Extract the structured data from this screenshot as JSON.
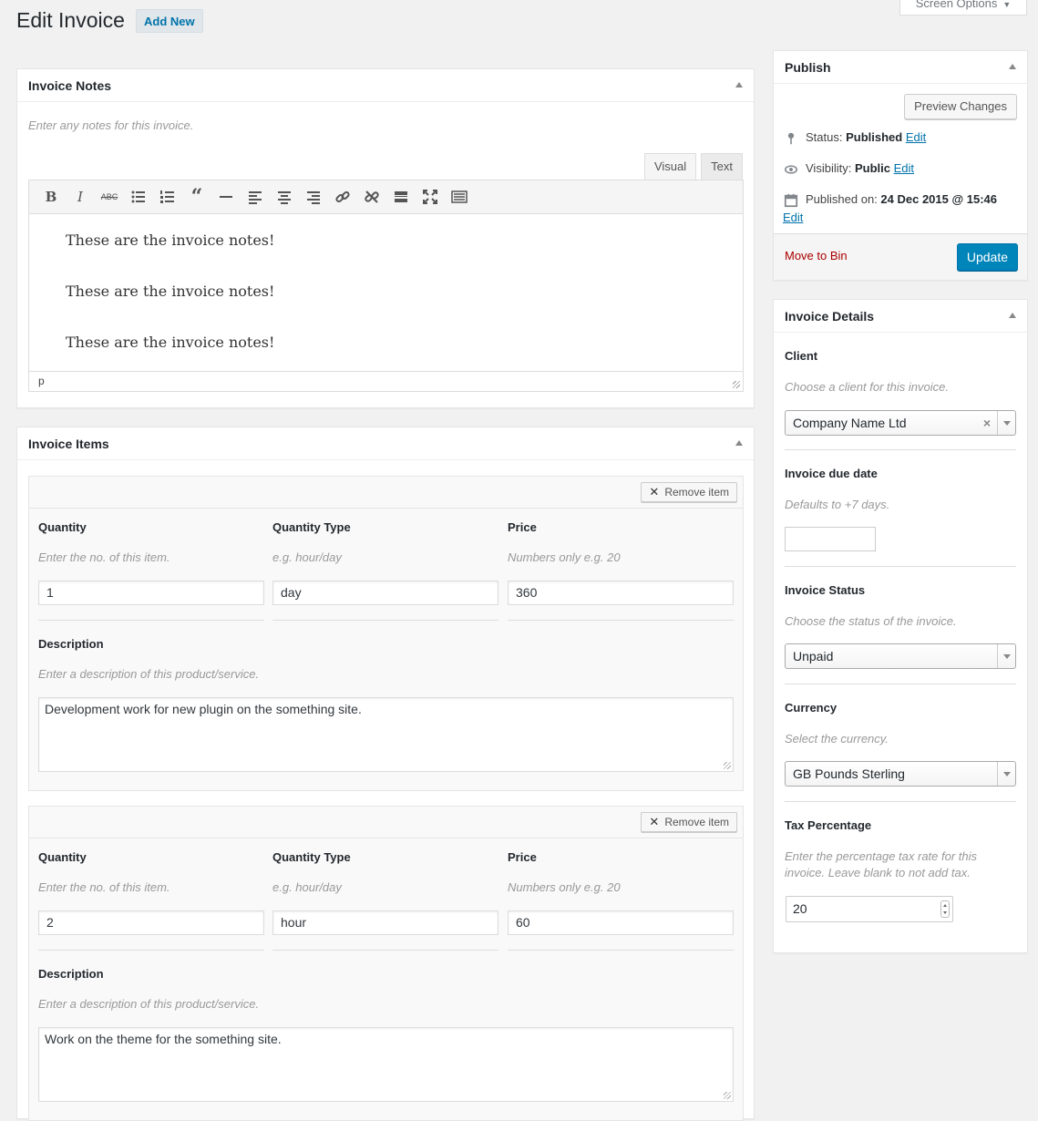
{
  "header": {
    "title": "Edit Invoice",
    "add_new": "Add New",
    "screen_options": "Screen Options"
  },
  "notes": {
    "title": "Invoice Notes",
    "hint": "Enter any notes for this invoice.",
    "tabs": [
      "Visual",
      "Text"
    ],
    "toolbar_icons": [
      "bold-icon",
      "italic-icon",
      "strikethrough-icon",
      "bullet-list-icon",
      "numbered-list-icon",
      "blockquote-icon",
      "horizontal-rule-icon",
      "align-left-icon",
      "align-center-icon",
      "align-right-icon",
      "insert-link-icon",
      "remove-link-icon",
      "read-more-icon",
      "fullscreen-icon",
      "toolbar-toggle-icon"
    ],
    "paragraphs": [
      "These are the invoice notes!",
      "These are the invoice notes!",
      "These are the invoice notes!"
    ],
    "status_path": "p"
  },
  "items": {
    "title": "Invoice Items",
    "remove_label": "Remove item",
    "labels": {
      "quantity": "Quantity",
      "quantity_type": "Quantity Type",
      "price": "Price",
      "description": "Description"
    },
    "hints": {
      "quantity": "Enter the no. of this item.",
      "quantity_type": "e.g. hour/day",
      "price": "Numbers only e.g. 20",
      "description": "Enter a description of this product/service."
    },
    "list": [
      {
        "quantity": "1",
        "quantity_type": "day",
        "price": "360",
        "description": "Development work for new plugin on the something site."
      },
      {
        "quantity": "2",
        "quantity_type": "hour",
        "price": "60",
        "description": "Work on the theme for the something site."
      }
    ]
  },
  "publish": {
    "title": "Publish",
    "preview": "Preview Changes",
    "status_label": "Status:",
    "status_value": "Published",
    "visibility_label": "Visibility:",
    "visibility_value": "Public",
    "published_label": "Published on:",
    "published_value": "24 Dec 2015 @ 15:46",
    "edit": "Edit",
    "move_to_bin": "Move to Bin",
    "update": "Update"
  },
  "details": {
    "title": "Invoice Details",
    "client_label": "Client",
    "client_hint": "Choose a client for this invoice.",
    "client_value": "Company Name Ltd",
    "due_label": "Invoice due date",
    "due_hint": "Defaults to +7 days.",
    "due_value": "",
    "status_label": "Invoice Status",
    "status_hint": "Choose the status of the invoice.",
    "status_value": "Unpaid",
    "currency_label": "Currency",
    "currency_hint": "Select the currency.",
    "currency_value": "GB Pounds Sterling",
    "tax_label": "Tax Percentage",
    "tax_hint": "Enter the percentage tax rate for this invoice. Leave blank to not add tax.",
    "tax_value": "20"
  },
  "colors": {
    "accent": "#0085ba",
    "link": "#0073aa",
    "danger": "#aa0000",
    "background": "#f1f1f1"
  }
}
